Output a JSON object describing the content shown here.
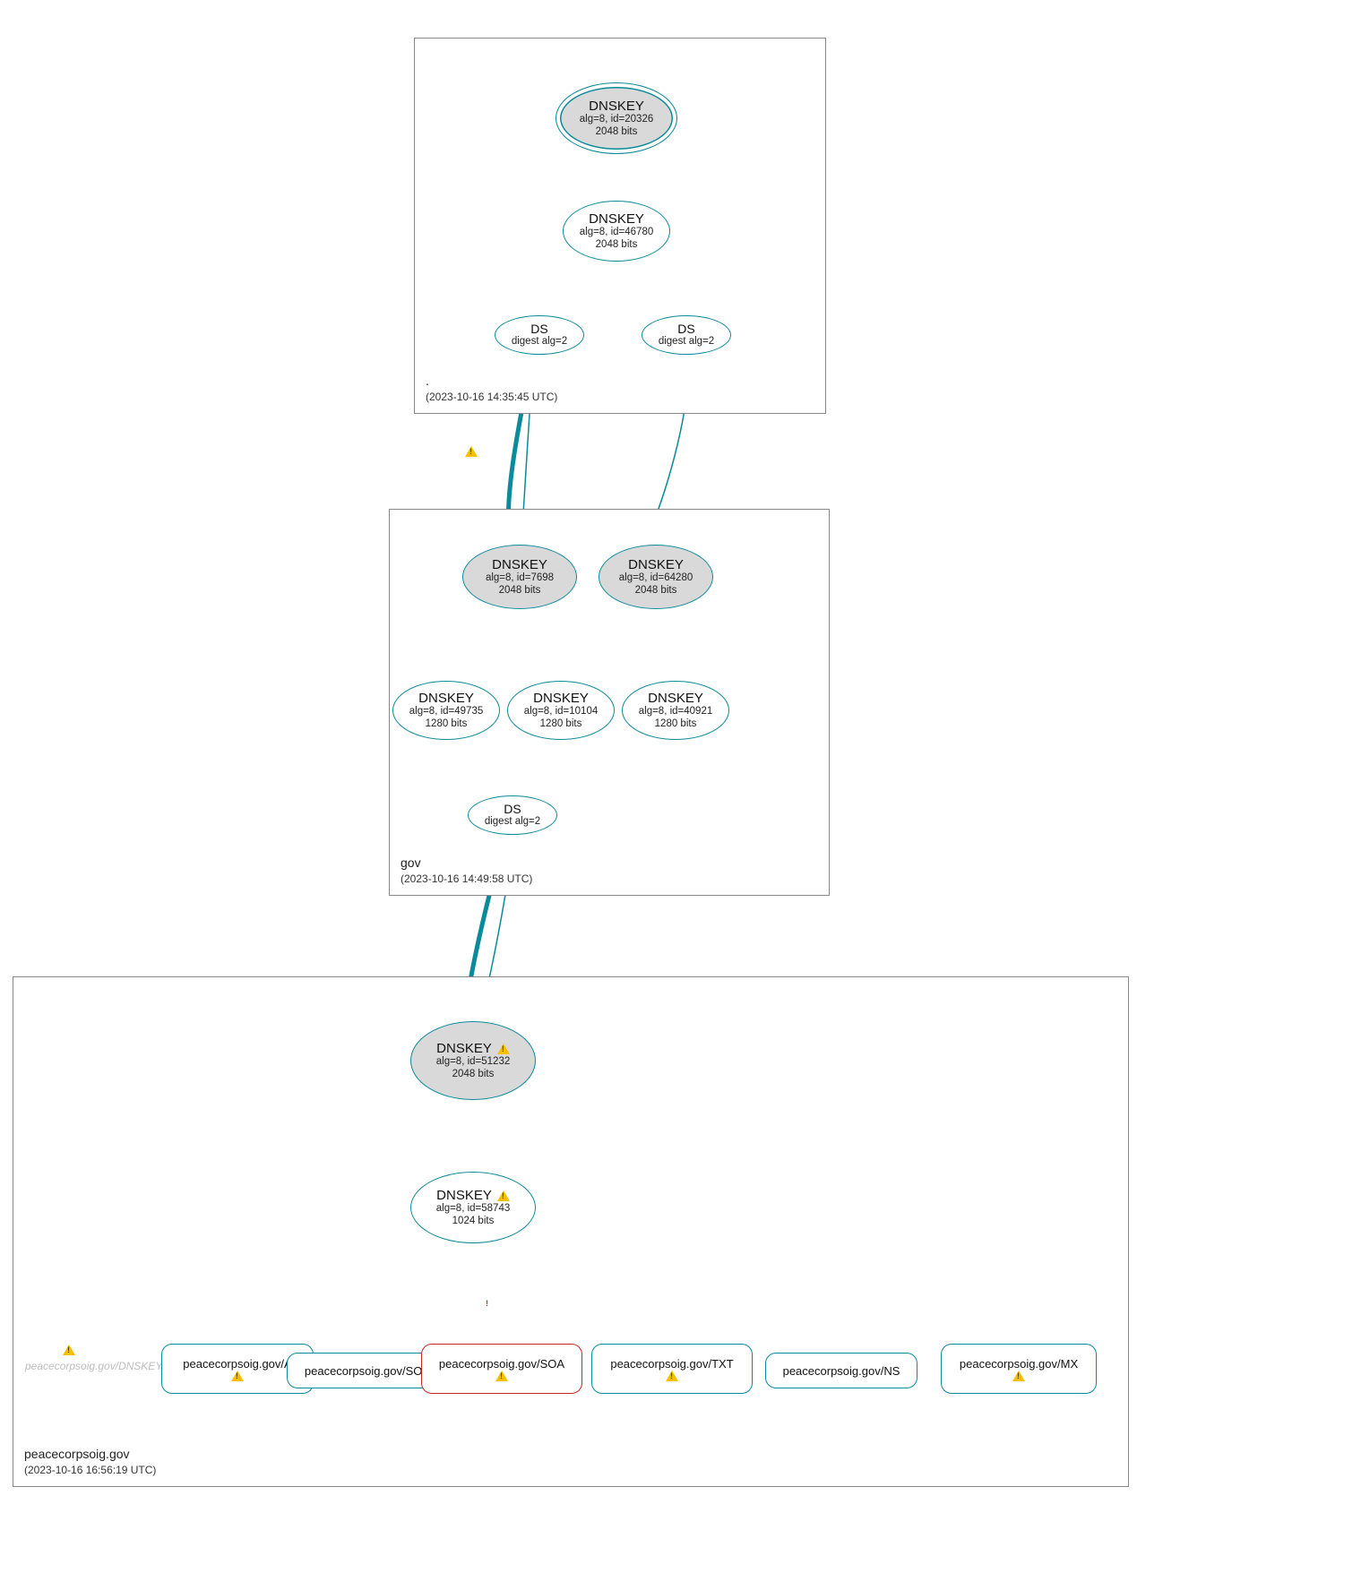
{
  "zones": {
    "root": {
      "name": ".",
      "timestamp": "(2023-10-16 14:35:45 UTC)"
    },
    "gov": {
      "name": "gov",
      "timestamp": "(2023-10-16 14:49:58 UTC)"
    },
    "leaf": {
      "name": "peacecorpsoig.gov",
      "timestamp": "(2023-10-16 16:56:19 UTC)"
    }
  },
  "nodes": {
    "root_ksk": {
      "title": "DNSKEY",
      "line1": "alg=8, id=20326",
      "line2": "2048 bits"
    },
    "root_zsk": {
      "title": "DNSKEY",
      "line1": "alg=8, id=46780",
      "line2": "2048 bits"
    },
    "root_ds1": {
      "title": "DS",
      "line1": "digest alg=2"
    },
    "root_ds2": {
      "title": "DS",
      "line1": "digest alg=2"
    },
    "gov_ksk1": {
      "title": "DNSKEY",
      "line1": "alg=8, id=7698",
      "line2": "2048 bits"
    },
    "gov_ksk2": {
      "title": "DNSKEY",
      "line1": "alg=8, id=64280",
      "line2": "2048 bits"
    },
    "gov_zsk1": {
      "title": "DNSKEY",
      "line1": "alg=8, id=49735",
      "line2": "1280 bits"
    },
    "gov_zsk2": {
      "title": "DNSKEY",
      "line1": "alg=8, id=10104",
      "line2": "1280 bits"
    },
    "gov_zsk3": {
      "title": "DNSKEY",
      "line1": "alg=8, id=40921",
      "line2": "1280 bits"
    },
    "gov_ds": {
      "title": "DS",
      "line1": "digest alg=2"
    },
    "leaf_ksk": {
      "title": "DNSKEY",
      "line1": "alg=8, id=51232",
      "line2": "2048 bits",
      "warn": true
    },
    "leaf_zsk": {
      "title": "DNSKEY",
      "line1": "alg=8, id=58743",
      "line2": "1024 bits",
      "warn": true
    },
    "rr_a": {
      "label": "peacecorpsoig.gov/A",
      "warn": true
    },
    "rr_soa1": {
      "label": "peacecorpsoig.gov/SOA"
    },
    "rr_soa2": {
      "label": "peacecorpsoig.gov/SOA",
      "warn": true,
      "error": true
    },
    "rr_txt": {
      "label": "peacecorpsoig.gov/TXT",
      "warn": true
    },
    "rr_ns": {
      "label": "peacecorpsoig.gov/NS"
    },
    "rr_mx": {
      "label": "peacecorpsoig.gov/MX",
      "warn": true
    },
    "leaf_dnskey_phantom": {
      "label": "peacecorpsoig.gov/DNSKEY"
    }
  },
  "colors": {
    "stroke": "#0a8a9a",
    "fill_grey": "#d9d9d9",
    "error": "#c62828",
    "purple": "#7b2fa0"
  }
}
